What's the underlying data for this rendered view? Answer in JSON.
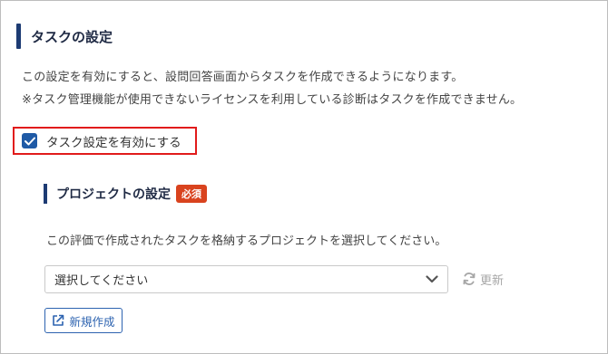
{
  "task_section": {
    "title": "タスクの設定",
    "description_line1": "この設定を有効にすると、設問回答画面からタスクを作成できるようになります。",
    "description_line2": "※タスク管理機能が使用できないライセンスを利用している診断はタスクを作成できません。",
    "enable_checkbox": {
      "label": "タスク設定を有効にする",
      "checked": true
    }
  },
  "project_section": {
    "title": "プロジェクトの設定",
    "required_badge": "必須",
    "description": "この評価で作成されたタスクを格納するプロジェクトを選択してください。",
    "select": {
      "selected": "選択してください"
    },
    "refresh_label": "更新",
    "new_button_label": "新規作成"
  },
  "colors": {
    "accent": "#1d3b73",
    "checkbox": "#1f5aa6",
    "badge": "#d9431e",
    "highlight_border": "#e11b1b",
    "button": "#2d63b0"
  },
  "icons": {
    "checkbox": "check-icon",
    "select": "chevron-down-icon",
    "refresh": "refresh-icon",
    "new": "external-link-icon"
  }
}
